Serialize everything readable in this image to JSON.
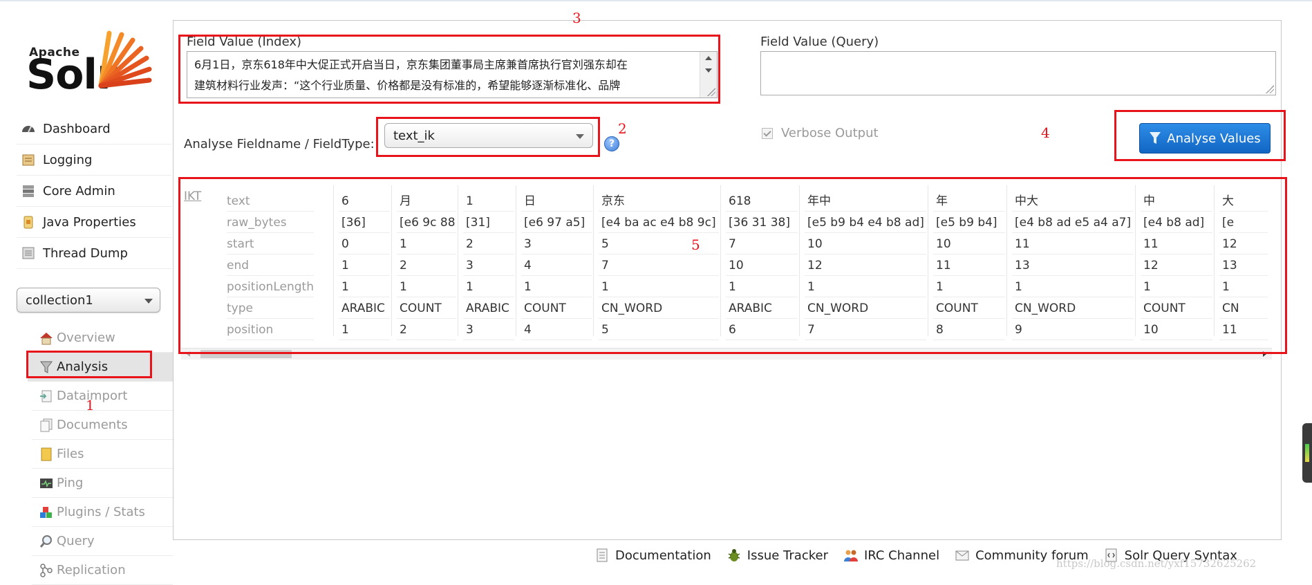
{
  "app": {
    "logo_small": "Apache",
    "logo_big": "Solr"
  },
  "sidebar": {
    "main_items": [
      {
        "label": "Dashboard",
        "icon": "dashboard-icon"
      },
      {
        "label": "Logging",
        "icon": "logging-icon"
      },
      {
        "label": "Core Admin",
        "icon": "core-admin-icon"
      },
      {
        "label": "Java Properties",
        "icon": "java-properties-icon"
      },
      {
        "label": "Thread Dump",
        "icon": "thread-dump-icon"
      }
    ],
    "core_selector": {
      "value": "collection1"
    },
    "core_items": [
      {
        "label": "Overview",
        "icon": "home-icon",
        "active": false
      },
      {
        "label": "Analysis",
        "icon": "funnel-icon",
        "active": true
      },
      {
        "label": "Dataimport",
        "icon": "dataimport-icon",
        "active": false
      },
      {
        "label": "Documents",
        "icon": "documents-icon",
        "active": false
      },
      {
        "label": "Files",
        "icon": "files-icon",
        "active": false
      },
      {
        "label": "Ping",
        "icon": "ping-icon",
        "active": false
      },
      {
        "label": "Plugins / Stats",
        "icon": "plugins-icon",
        "active": false
      },
      {
        "label": "Query",
        "icon": "query-icon",
        "active": false
      },
      {
        "label": "Replication",
        "icon": "replication-icon",
        "active": false
      }
    ]
  },
  "analysis": {
    "index_label": "Field Value (Index)",
    "index_value_lines": [
      "6月1日，京东618年中大促正式开启当日，京东集团董事局主席兼首席执行官刘强东却在",
      "建筑材料行业发声：“这个行业质量、价格都是没有标准的，希望能够逐渐标准化、品牌"
    ],
    "query_label": "Field Value (Query)",
    "query_value": "",
    "fieldtype_label": "Analyse Fieldname / FieldType:",
    "fieldtype_value": "text_ik",
    "help_glyph": "?",
    "verbose_label": "Verbose Output",
    "verbose_checked": true,
    "analyse_button": "Analyse Values"
  },
  "results": {
    "analyzer": "IKT",
    "row_labels": [
      "text",
      "raw_bytes",
      "start",
      "end",
      "positionLength",
      "type",
      "position"
    ],
    "tokens": [
      {
        "text": "6",
        "raw_bytes": "[36]",
        "start": "0",
        "end": "1",
        "positionLength": "1",
        "type": "ARABIC",
        "position": "1"
      },
      {
        "text": "月",
        "raw_bytes": "[e6 9c 88]",
        "start": "1",
        "end": "2",
        "positionLength": "1",
        "type": "COUNT",
        "position": "2"
      },
      {
        "text": "1",
        "raw_bytes": "[31]",
        "start": "2",
        "end": "3",
        "positionLength": "1",
        "type": "ARABIC",
        "position": "3"
      },
      {
        "text": "日",
        "raw_bytes": "[e6 97 a5]",
        "start": "3",
        "end": "4",
        "positionLength": "1",
        "type": "COUNT",
        "position": "4"
      },
      {
        "text": "京东",
        "raw_bytes": "[e4 ba ac e4 b8 9c]",
        "start": "5",
        "end": "7",
        "positionLength": "1",
        "type": "CN_WORD",
        "position": "5"
      },
      {
        "text": "618",
        "raw_bytes": "[36 31 38]",
        "start": "7",
        "end": "10",
        "positionLength": "1",
        "type": "ARABIC",
        "position": "6"
      },
      {
        "text": "年中",
        "raw_bytes": "[e5 b9 b4 e4 b8 ad]",
        "start": "10",
        "end": "12",
        "positionLength": "1",
        "type": "CN_WORD",
        "position": "7"
      },
      {
        "text": "年",
        "raw_bytes": "[e5 b9 b4]",
        "start": "10",
        "end": "11",
        "positionLength": "1",
        "type": "COUNT",
        "position": "8"
      },
      {
        "text": "中大",
        "raw_bytes": "[e4 b8 ad e5 a4 a7]",
        "start": "11",
        "end": "13",
        "positionLength": "1",
        "type": "CN_WORD",
        "position": "9"
      },
      {
        "text": "中",
        "raw_bytes": "[e4 b8 ad]",
        "start": "11",
        "end": "12",
        "positionLength": "1",
        "type": "COUNT",
        "position": "10"
      },
      {
        "text": "大",
        "raw_bytes": "[e",
        "start": "12",
        "end": "13",
        "positionLength": "1",
        "type": "CN",
        "position": "11"
      }
    ]
  },
  "annotations": [
    "1",
    "2",
    "3",
    "4",
    "5"
  ],
  "footer": {
    "links": [
      {
        "label": "Documentation",
        "icon": "documentation-icon"
      },
      {
        "label": "Issue Tracker",
        "icon": "bug-icon"
      },
      {
        "label": "IRC Channel",
        "icon": "irc-icon"
      },
      {
        "label": "Community forum",
        "icon": "mail-icon"
      },
      {
        "label": "Solr Query Syntax",
        "icon": "query-syntax-icon"
      }
    ],
    "watermark": "https://blog.csdn.net/yxf15732625262"
  },
  "colors": {
    "accent": "#1a73d1",
    "annotation": "#e8141c",
    "muted": "#9a9a9a"
  }
}
